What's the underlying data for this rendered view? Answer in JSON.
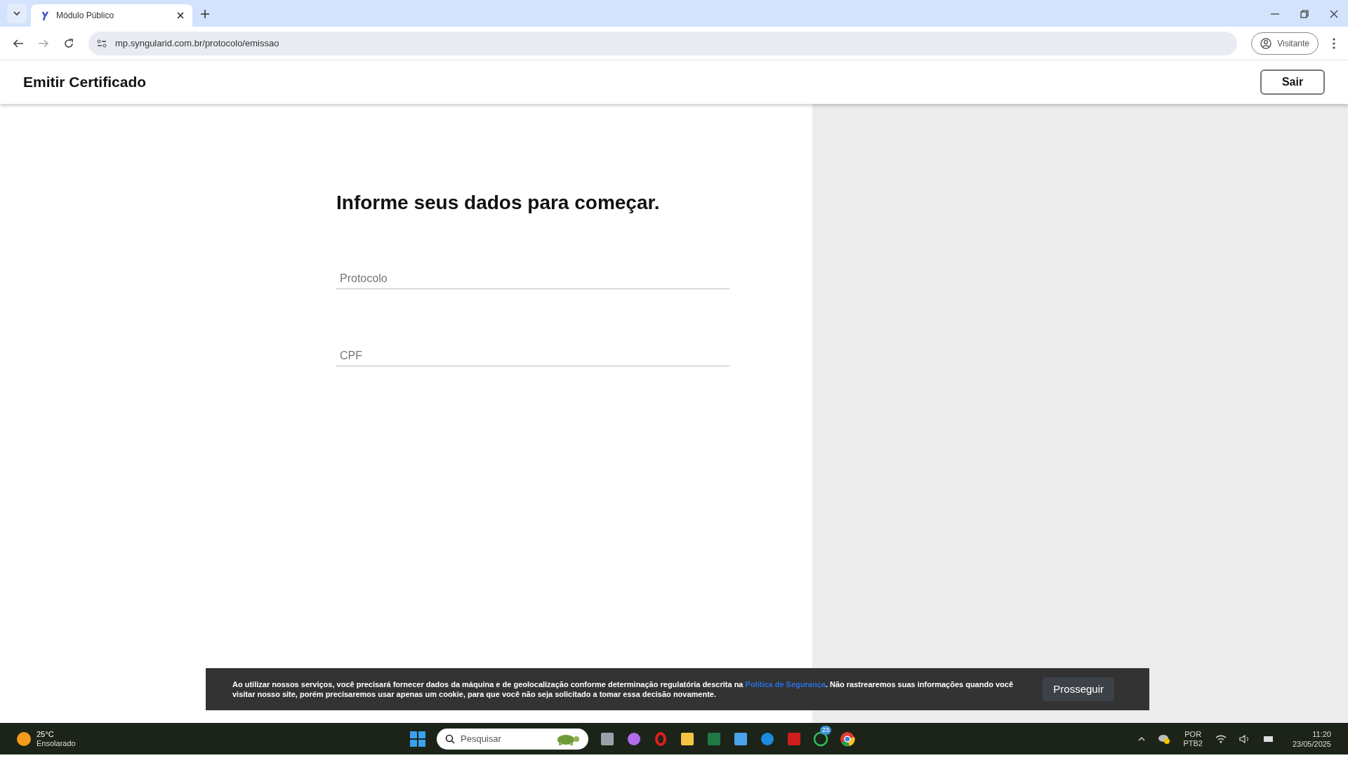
{
  "browser": {
    "tab": {
      "title": "Módulo Público",
      "selected": true
    },
    "url": "mp.syngularid.com.br/protocolo/emissao",
    "profile": "Visitante"
  },
  "header": {
    "title": "Emitir Certificado",
    "logout": "Sair"
  },
  "form": {
    "heading": "Informe seus dados para começar.",
    "fields": [
      {
        "placeholder": "Protocolo"
      },
      {
        "placeholder": "CPF"
      }
    ]
  },
  "cookie_banner": {
    "text_before": "Ao utilizar nossos serviços, você precisará fornecer dados da máquina e de geolocalização conforme determinação regulatória descrita na",
    "link": "Política de Segurança",
    "text_after": ". Não rastrearemos suas informações quando você visitar nosso site, porém precisaremos usar apenas um cookie, para que você não seja solicitado a tomar essa decisão novamente.",
    "button": "Prosseguir"
  },
  "taskbar": {
    "weather": {
      "temp": "25°C",
      "condition": "Ensolarado"
    },
    "search": {
      "placeholder": "Pesquisar"
    },
    "whatsapp_badge": "23",
    "language": {
      "top": "POR",
      "bottom": "PTB2"
    },
    "time": "11:20",
    "date": "23/05/2025"
  }
}
